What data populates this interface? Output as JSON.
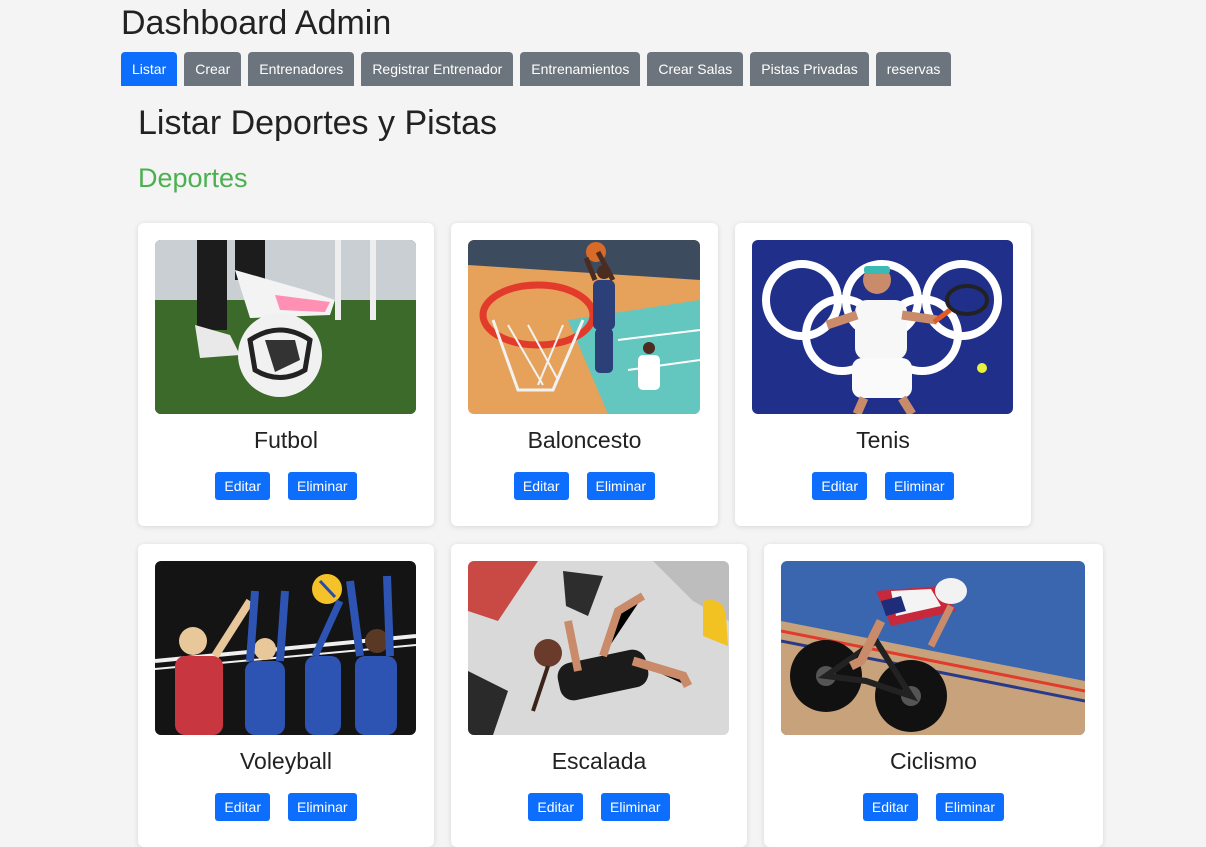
{
  "app": {
    "title": "Dashboard Admin"
  },
  "nav": [
    {
      "label": "Listar",
      "active": true
    },
    {
      "label": "Crear"
    },
    {
      "label": "Entrenadores"
    },
    {
      "label": "Registrar Entrenador"
    },
    {
      "label": "Entrenamientos"
    },
    {
      "label": "Crear Salas"
    },
    {
      "label": "Pistas Privadas"
    },
    {
      "label": "reservas"
    }
  ],
  "main": {
    "title": "Listar Deportes y Pistas",
    "section_title": "Deportes",
    "section_color": "#4caf50"
  },
  "actions": {
    "edit_label": "Editar",
    "delete_label": "Eliminar"
  },
  "sports": [
    {
      "name": "Futbol",
      "image": "soccer-photo"
    },
    {
      "name": "Baloncesto",
      "image": "basketball-photo"
    },
    {
      "name": "Tenis",
      "image": "tennis-photo"
    },
    {
      "name": "Voleyball",
      "image": "volleyball-photo"
    },
    {
      "name": "Escalada",
      "image": "climbing-photo"
    },
    {
      "name": "Ciclismo",
      "image": "cycling-photo"
    }
  ],
  "colors": {
    "primary": "#0d6efd",
    "secondary": "#6c757d",
    "accent": "#4caf50"
  }
}
